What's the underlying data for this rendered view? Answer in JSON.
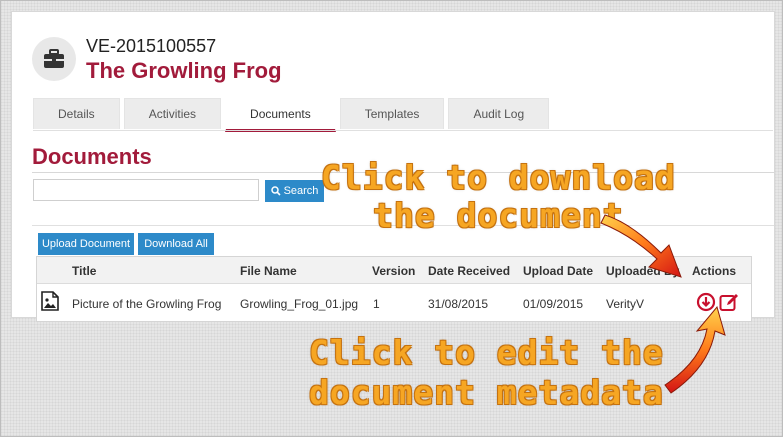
{
  "header": {
    "record_id": "VE-2015100557",
    "record_name": "The Growling Frog",
    "icon": "briefcase-icon"
  },
  "tabs": [
    {
      "label": "Details",
      "active": false
    },
    {
      "label": "Activities",
      "active": false
    },
    {
      "label": "Documents",
      "active": true
    },
    {
      "label": "Templates",
      "active": false
    },
    {
      "label": "Audit Log",
      "active": false
    }
  ],
  "section": {
    "title": "Documents"
  },
  "search": {
    "value": "",
    "placeholder": "",
    "button_label": "Search"
  },
  "actions": {
    "upload_label": "Upload Document",
    "download_all_label": "Download All"
  },
  "table": {
    "columns": [
      "Title",
      "File Name",
      "Version",
      "Date Received",
      "Upload Date",
      "Uploaded By",
      "Actions"
    ],
    "rows": [
      {
        "title": "Picture of the Growling Frog",
        "file_name": "Growling_Frog_01.jpg",
        "version": "1",
        "date_received": "31/08/2015",
        "upload_date": "01/09/2015",
        "uploaded_by": "VerityV"
      }
    ]
  },
  "annotations": {
    "download": [
      "Click to download",
      "the document"
    ],
    "edit": [
      "Click to edit the",
      "document metadata"
    ]
  },
  "colors": {
    "accent": "#a21b3b",
    "button": "#2d8ac9",
    "callout_text": "#f6a623"
  }
}
